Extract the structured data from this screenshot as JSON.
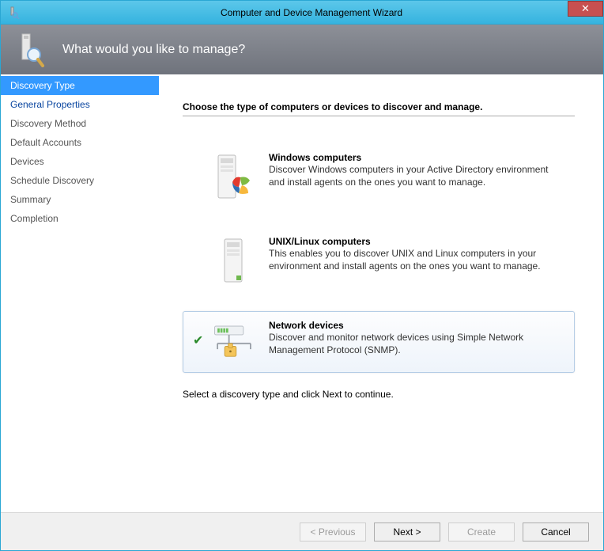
{
  "window": {
    "title": "Computer and Device Management Wizard"
  },
  "banner": {
    "heading": "What would you like to manage?"
  },
  "sidebar": {
    "steps": [
      {
        "label": "Discovery Type",
        "state": "active"
      },
      {
        "label": "General Properties",
        "state": "link"
      },
      {
        "label": "Discovery Method",
        "state": "disabled"
      },
      {
        "label": "Default Accounts",
        "state": "disabled"
      },
      {
        "label": "Devices",
        "state": "disabled"
      },
      {
        "label": "Schedule Discovery",
        "state": "disabled"
      },
      {
        "label": "Summary",
        "state": "disabled"
      },
      {
        "label": "Completion",
        "state": "disabled"
      }
    ]
  },
  "content": {
    "title": "Choose the type of computers or devices to discover and manage.",
    "options": [
      {
        "title": "Windows computers",
        "desc": "Discover Windows computers in your Active Directory environment and install agents on the ones you want to manage.",
        "selected": false
      },
      {
        "title": "UNIX/Linux computers",
        "desc": "This enables you to discover UNIX and Linux computers in your environment and install agents on the ones you want to manage.",
        "selected": false
      },
      {
        "title": "Network devices",
        "desc": "Discover and monitor network devices using Simple Network Management Protocol (SNMP).",
        "selected": true
      }
    ],
    "hint": "Select a discovery type and click Next to continue."
  },
  "footer": {
    "previous": "< Previous",
    "next": "Next >",
    "create": "Create",
    "cancel": "Cancel"
  }
}
